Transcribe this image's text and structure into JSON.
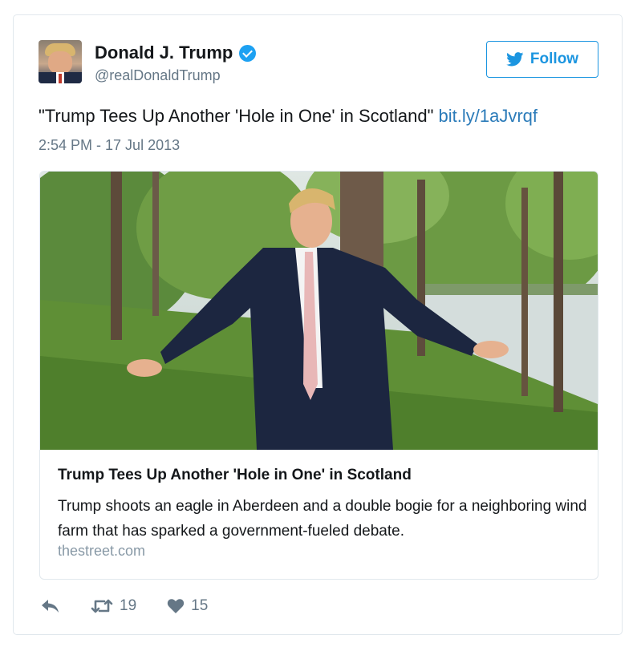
{
  "author": {
    "name": "Donald J. Trump",
    "handle": "@realDonaldTrump",
    "verified": true
  },
  "follow_button": {
    "label": "Follow",
    "icon": "twitter-bird-icon"
  },
  "tweet": {
    "text": "\"Trump Tees Up Another 'Hole in One' in Scotland\"",
    "link": "bit.ly/1aJvrqf",
    "timestamp": "2:54 PM - 17 Jul 2013"
  },
  "card": {
    "image": "man-in-suit-with-arms-outstretched-by-trees-and-river",
    "title": "Trump Tees Up Another 'Hole in One' in Scotland",
    "description": "Trump shoots an eagle in Aberdeen and a double bogie for a neighboring wind farm that has sparked a government-fueled debate.",
    "domain": "thestreet.com"
  },
  "actions": {
    "reply_icon": "reply-icon",
    "retweet_icon": "retweet-icon",
    "retweet_count": "19",
    "like_icon": "heart-icon",
    "like_count": "15"
  },
  "colors": {
    "link": "#2b7bb9",
    "follow": "#1b95e0",
    "verified": "#1da1f2",
    "muted": "#657786",
    "border": "#e1e8ed"
  }
}
